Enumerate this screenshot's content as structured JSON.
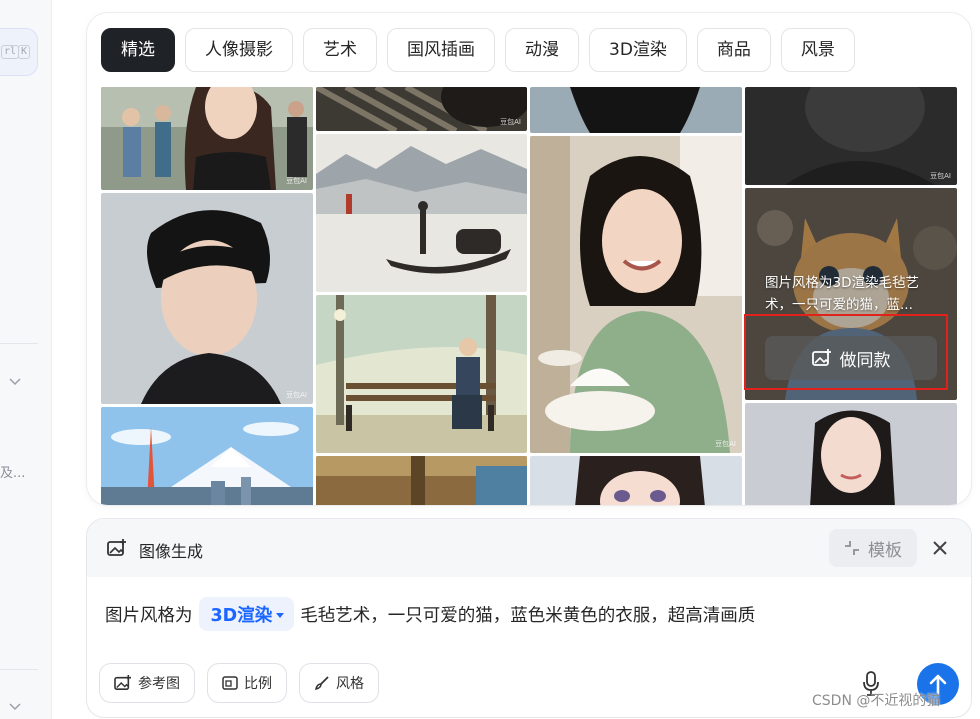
{
  "sidebar": {
    "shortcut_keys": [
      "rl",
      "K"
    ],
    "truncated_text": "及..."
  },
  "tabs": [
    {
      "label": "精选",
      "active": true
    },
    {
      "label": "人像摄影"
    },
    {
      "label": "艺术"
    },
    {
      "label": "国风插画"
    },
    {
      "label": "动漫"
    },
    {
      "label": "3D渲染"
    },
    {
      "label": "商品"
    },
    {
      "label": "风景"
    }
  ],
  "gallery": {
    "watermark": "豆包AI",
    "hover_card": {
      "description": "图片风格为3D渲染毛毡艺术，一只可爱的猫，蓝...",
      "button_label": "做同款"
    }
  },
  "composer": {
    "title": "图像生成",
    "template_label": "模板",
    "prompt_before": "图片风格为",
    "style_chip": "3D渲染",
    "prompt_after": "毛毡艺术，一只可爱的猫，蓝色米黄色的衣服，超高清画质",
    "tools": [
      {
        "label": "参考图",
        "icon": "image-plus-icon"
      },
      {
        "label": "比例",
        "icon": "aspect-ratio-icon"
      },
      {
        "label": "风格",
        "icon": "brush-icon"
      }
    ]
  },
  "watermark_text": "CSDN @不近视的猫",
  "colors": {
    "active_tab": "#1f2227",
    "accent_blue": "#1a73e8",
    "chip_text": "#1a66ff",
    "highlight_red": "#e0221d"
  }
}
